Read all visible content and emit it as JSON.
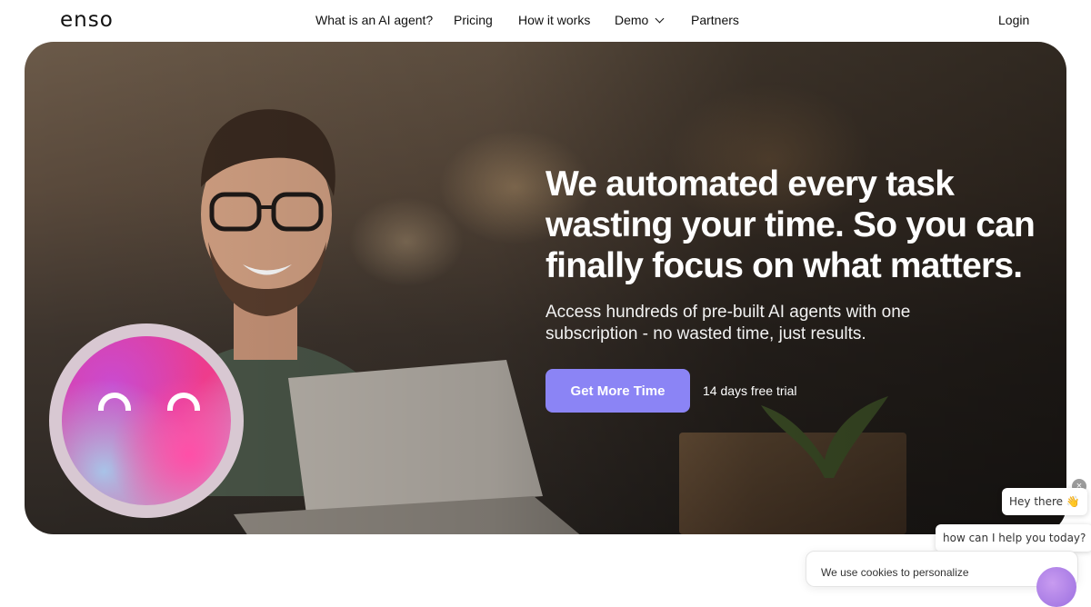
{
  "nav": {
    "logo": "enso",
    "links": [
      "What is an AI agent?",
      "Pricing",
      "How it works",
      "Demo",
      "Partners"
    ],
    "login": "Login"
  },
  "hero": {
    "headline": "We automated every task wasting your time. So you can finally focus on what matters.",
    "subheadline": "Access hundreds of pre-built AI agents with one subscription - no wasted time, just results.",
    "cta": "Get More Time",
    "trial": "14 days free trial"
  },
  "chat": {
    "greeting": "Hey there 👋",
    "question": "how can I help you today?",
    "close": "×"
  },
  "cookie": {
    "text": "We use cookies to personalize"
  },
  "colors": {
    "cta": "#8b84f5",
    "text": "#111111"
  }
}
